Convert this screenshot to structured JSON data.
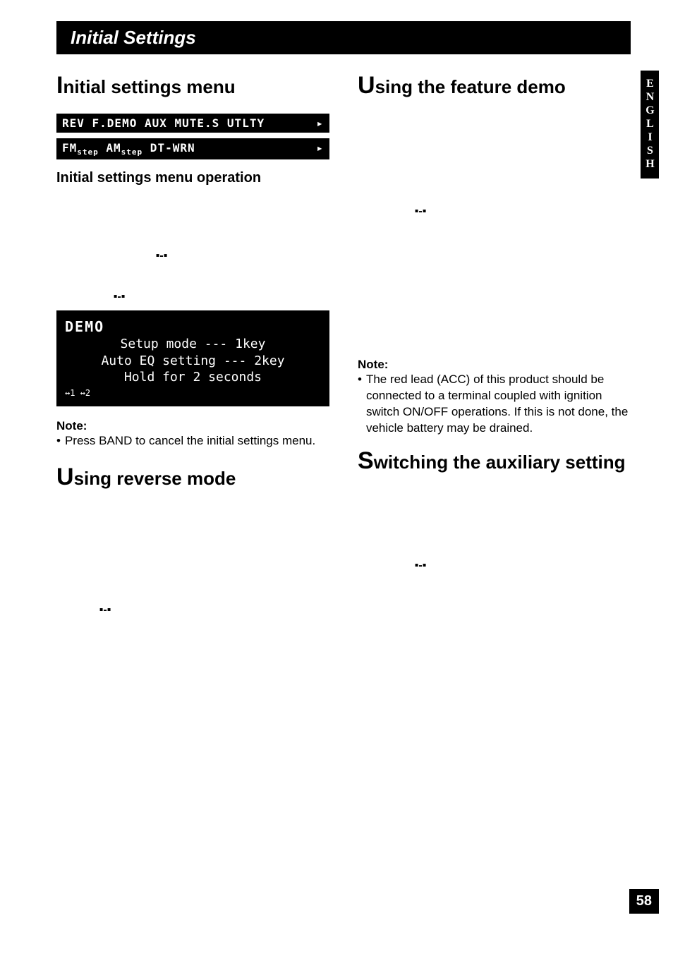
{
  "banner": "Initial Settings",
  "side_tab": "ENGLISH",
  "page_number": "58",
  "left": {
    "h1_cap": "I",
    "h1_rest": "nitial settings menu",
    "display_line_1": "REV  F.DEMO  AUX            MUTE.S  UTLTY",
    "display_line_2_a": "FM",
    "display_line_2_b": "step",
    "display_line_2_c": " AM",
    "display_line_2_d": "step",
    "display_line_2_e": " DT-WRN",
    "h2_operation": "Initial settings menu operation",
    "lcd": {
      "label": "DEMO",
      "l1": "Setup mode --- 1key",
      "l2": "Auto EQ setting --- 2key",
      "l3": "Hold for 2 seconds",
      "bottom": "↔1   ↔2"
    },
    "note_label": "Note:",
    "note_text": "Press BAND to cancel the initial settings menu.",
    "h1b_cap": "U",
    "h1b_rest": "sing reverse mode"
  },
  "right": {
    "h1_cap": "U",
    "h1_rest": "sing the feature demo",
    "note_label": "Note:",
    "note_text": "The red lead (ACC) of this product should be connected to a terminal coupled with ignition switch ON/OFF operations. If this is not done, the vehicle battery may be drained.",
    "h1b_cap": "S",
    "h1b_rest": "witching the auxiliary setting"
  }
}
